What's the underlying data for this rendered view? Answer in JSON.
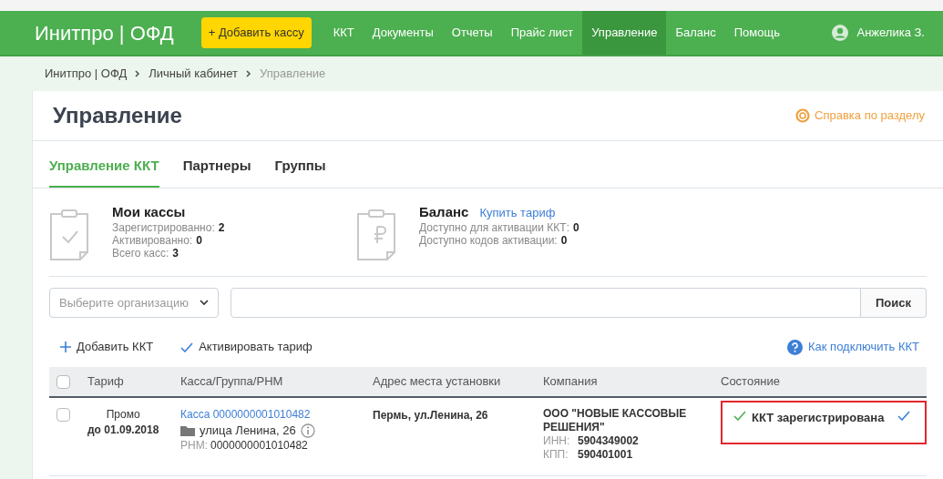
{
  "header": {
    "logo": "Инитпро | ОФД",
    "add_button": "+ Добавить кассу",
    "nav": [
      {
        "label": "ККТ",
        "selected": false
      },
      {
        "label": "Документы",
        "selected": false
      },
      {
        "label": "Отчеты",
        "selected": false
      },
      {
        "label": "Прайс лист",
        "selected": false
      },
      {
        "label": "Управление",
        "selected": true
      },
      {
        "label": "Баланс",
        "selected": false
      },
      {
        "label": "Помощь",
        "selected": false
      }
    ],
    "user": "Анжелика З."
  },
  "breadcrumbs": [
    "Инитпро | ОФД",
    "Личный кабинет",
    "Управление"
  ],
  "page": {
    "title": "Управление",
    "help_link": "Справка по разделу"
  },
  "tabs": [
    {
      "label": "Управление ККТ",
      "selected": true
    },
    {
      "label": "Партнеры",
      "selected": false
    },
    {
      "label": "Группы",
      "selected": false
    }
  ],
  "summary": [
    {
      "kind": "registers",
      "title": "Мои кассы",
      "stats": [
        {
          "label": "Зарегистрированно:",
          "value": "2"
        },
        {
          "label": "Активированно:",
          "value": "0"
        },
        {
          "label": "Всего касс:",
          "value": "3"
        }
      ]
    },
    {
      "kind": "balance",
      "title": "Баланс",
      "link": "Купить тариф",
      "stats": [
        {
          "label": "Доступно для активации ККТ:",
          "value": "0"
        },
        {
          "label": "Доступно кодов активации:",
          "value": "0"
        }
      ]
    }
  ],
  "filter": {
    "organization_placeholder": "Выберите организацию",
    "search_button": "Поиск"
  },
  "actions": [
    {
      "kind": "add",
      "label": "Добавить ККТ"
    },
    {
      "kind": "activate",
      "label": "Активировать тариф"
    }
  ],
  "help_connect": "Как подключить ККТ",
  "table": {
    "columns": [
      "Тариф",
      "Касса/Группа/РНМ",
      "Адрес места установки",
      "Компания",
      "Состояние"
    ],
    "header_checked": false,
    "rows": [
      {
        "checked": false,
        "tariff": "Промо",
        "tariff_until": "до 01.09.2018",
        "register_link": "Касса 0000000001010482",
        "group": "улица Ленина, 26",
        "rnm_label": "РНМ:",
        "rnm": "0000000001010482",
        "address": "Пермь, ул.Ленина, 26",
        "company": "ООО \"НОВЫЕ КАССОВЫЕ РЕШЕНИЯ\"",
        "inn_label": "ИНН:",
        "inn": "5904349002",
        "kpp_label": "КПП:",
        "kpp": "590401001",
        "status": "ККТ зарегистрирована",
        "status_ok": true,
        "highlighted": true
      }
    ]
  }
}
